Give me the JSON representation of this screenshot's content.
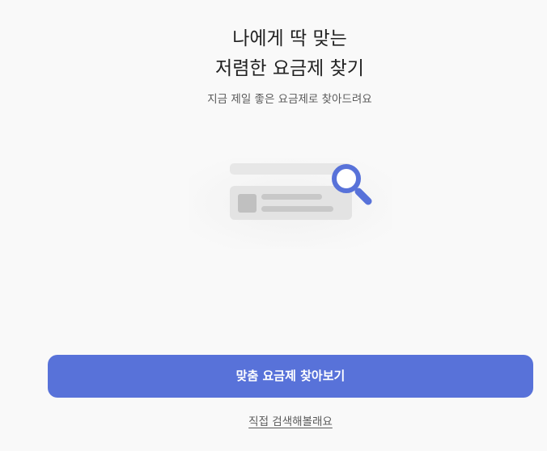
{
  "header": {
    "title_line1": "나에게 딱 맞는",
    "title_line2": "저렴한 요금제 찾기",
    "subtitle": "지금 제일 좋은 요금제로 찾아드려요"
  },
  "illustration": {
    "icon": "magnifier-search-icon",
    "accent_color": "#5872d9"
  },
  "actions": {
    "primary_label": "맞춤 요금제 찾아보기",
    "secondary_label": "직접 검색해볼래요"
  },
  "colors": {
    "primary": "#5872d9",
    "background": "#f9f9f9"
  }
}
